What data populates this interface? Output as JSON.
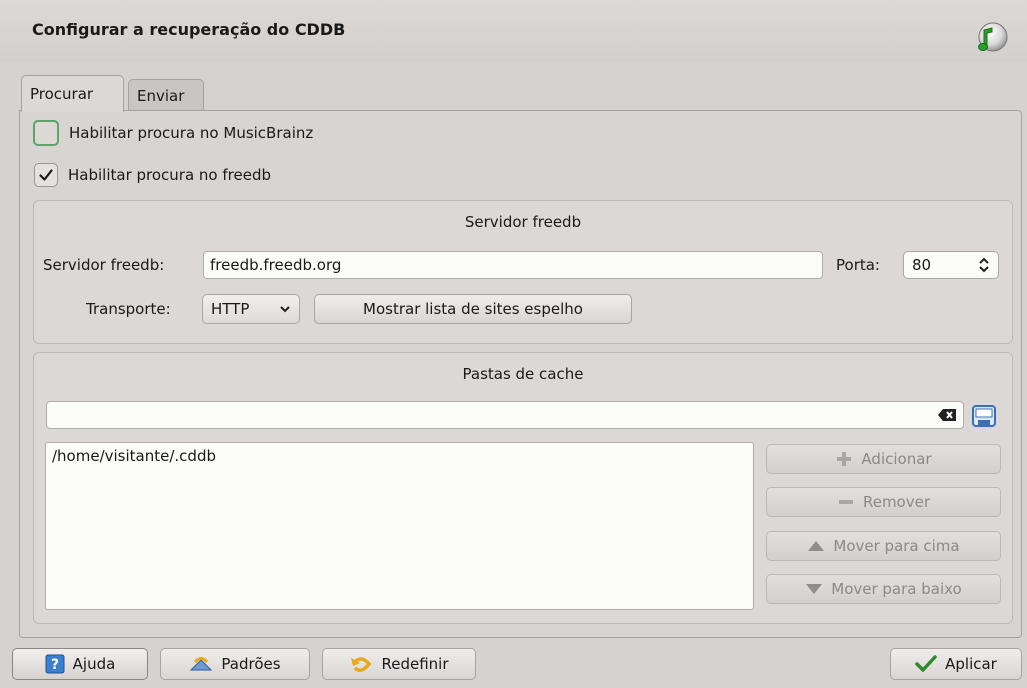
{
  "window": {
    "title": "Configurar a recuperação do CDDB",
    "icon": "music-note-icon"
  },
  "tabs": [
    {
      "label": "Procurar",
      "active": true
    },
    {
      "label": "Enviar",
      "active": false
    }
  ],
  "options": {
    "musicbrainz": {
      "label": "Habilitar procura no MusicBrainz",
      "checked": false
    },
    "freedb": {
      "label": "Habilitar procura no freedb",
      "checked": true
    }
  },
  "server_group": {
    "title": "Servidor freedb",
    "server_label": "Servidor freedb:",
    "server_value": "freedb.freedb.org",
    "port_label": "Porta:",
    "port_value": "80",
    "transport_label": "Transporte:",
    "transport_value": "HTTP",
    "mirror_button": "Mostrar lista de sites espelho"
  },
  "cache_group": {
    "title": "Pastas de cache",
    "path_value": "",
    "folders": [
      "/home/visitante/.cddb"
    ],
    "buttons": {
      "add": "Adicionar",
      "remove": "Remover",
      "move_up": "Mover para cima",
      "move_down": "Mover para baixo"
    }
  },
  "footer": {
    "help": "Ajuda",
    "defaults": "Padrões",
    "reset": "Redefinir",
    "apply": "Aplicar"
  },
  "colors": {
    "check_green": "#2f8a2f",
    "focus_ring": "#5fa36a",
    "help_blue": "#3a7fd0"
  }
}
